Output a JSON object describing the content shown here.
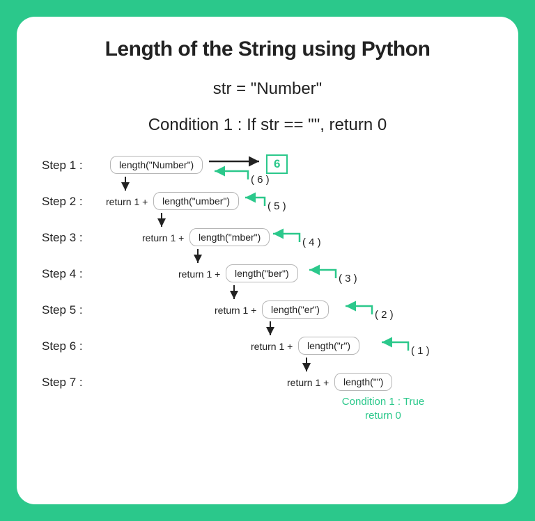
{
  "title": "Length of the String using Python",
  "subtitle": "str = \"Number\"",
  "condition": "Condition 1 : If str == \"\", return 0",
  "result": "6",
  "steps": [
    {
      "label": "Step 1 :",
      "call": "length(\"Number\")",
      "ret": "( 6 )"
    },
    {
      "label": "Step 2 :",
      "prefix": "return 1 +",
      "call": "length(\"umber\")",
      "ret": "( 5 )"
    },
    {
      "label": "Step 3 :",
      "prefix": "return 1 +",
      "call": "length(\"mber\")",
      "ret": "( 4 )"
    },
    {
      "label": "Step 4 :",
      "prefix": "return 1 +",
      "call": "length(\"ber\")",
      "ret": "( 3 )"
    },
    {
      "label": "Step 5 :",
      "prefix": "return 1 +",
      "call": "length(\"er\")",
      "ret": "( 2 )"
    },
    {
      "label": "Step 6 :",
      "prefix": "return 1 +",
      "call": "length(\"r\")",
      "ret": "( 1 )"
    },
    {
      "label": "Step 7 :",
      "prefix": "return 1 +",
      "call": "length(\"\")"
    }
  ],
  "final": "Condition 1 : True\nreturn 0"
}
